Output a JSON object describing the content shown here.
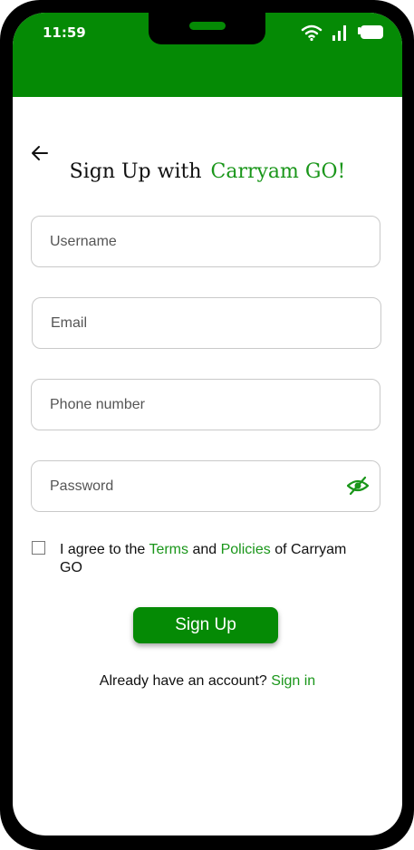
{
  "status_bar": {
    "time": "11:59",
    "icons": [
      "wifi-icon",
      "signal-icon",
      "battery-icon"
    ]
  },
  "header": {
    "title_prefix": "Sign Up with",
    "title_brand": "Carryam GO!"
  },
  "form": {
    "username_placeholder": "Username",
    "email_placeholder": "Email",
    "phone_placeholder": "Phone number",
    "password_placeholder": "Password"
  },
  "agreement": {
    "prefix": "I agree to the ",
    "terms": "Terms",
    "and": " and ",
    "policies": "Policies",
    "suffix": " of Carryam GO",
    "checked": false
  },
  "signup_label": "Sign Up",
  "footer": {
    "prompt": "Already have an account? ",
    "signin": "Sign in"
  },
  "colors": {
    "brand_green": "#058a05",
    "link_green": "#1a961a"
  }
}
